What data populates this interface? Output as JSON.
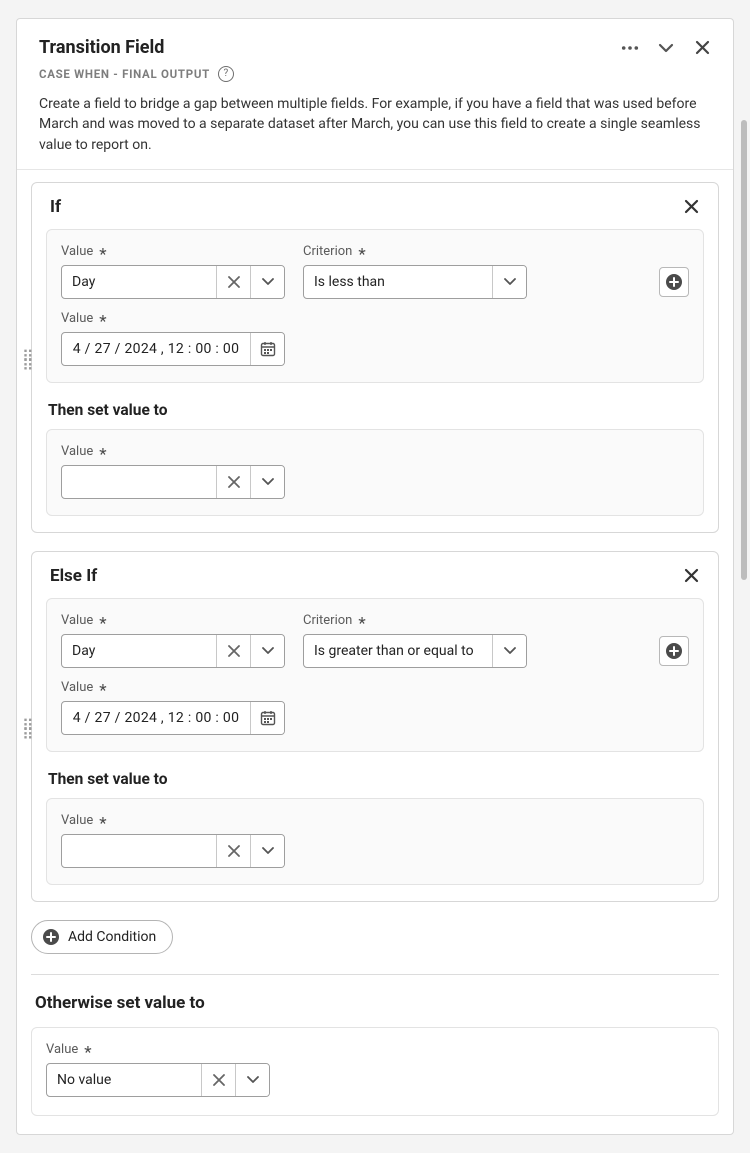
{
  "header": {
    "title": "Transition Field",
    "subtitle": "CASE WHEN - FINAL OUTPUT",
    "description": "Create a field to bridge a gap between multiple fields. For example, if you have a field that was used before March and was moved to a separate dataset after March, you can use this field to create a single seamless value to report on."
  },
  "labels": {
    "value": "Value",
    "criterion": "Criterion",
    "then_set_value_to": "Then set value to",
    "add_condition": "Add Condition",
    "otherwise_set_value_to": "Otherwise set value to"
  },
  "conditions": [
    {
      "title": "If",
      "value_field": "Day",
      "criterion": "Is less than",
      "date_value": "4 / 27 / 2024 ,   12 : 00 : 00",
      "then_value": ""
    },
    {
      "title": "Else If",
      "value_field": "Day",
      "criterion": "Is greater than or equal to",
      "date_value": "4 / 27 / 2024 ,   12 : 00 : 00",
      "then_value": ""
    }
  ],
  "otherwise": {
    "value": "No value"
  }
}
